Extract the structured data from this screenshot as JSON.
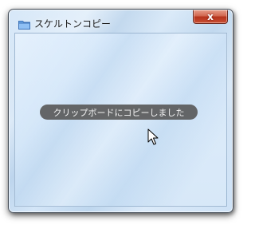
{
  "window": {
    "title": "スケルトンコピー",
    "close_label": "x"
  },
  "toast": {
    "message": "クリップボードにコピーしました"
  },
  "icons": {
    "app": "folder-icon",
    "close": "close-icon",
    "cursor": "mouse-cursor-icon"
  },
  "colors": {
    "close_button": "#c84f34",
    "toast_background": "#5a5a5a",
    "window_background": "#cfe3f7"
  }
}
